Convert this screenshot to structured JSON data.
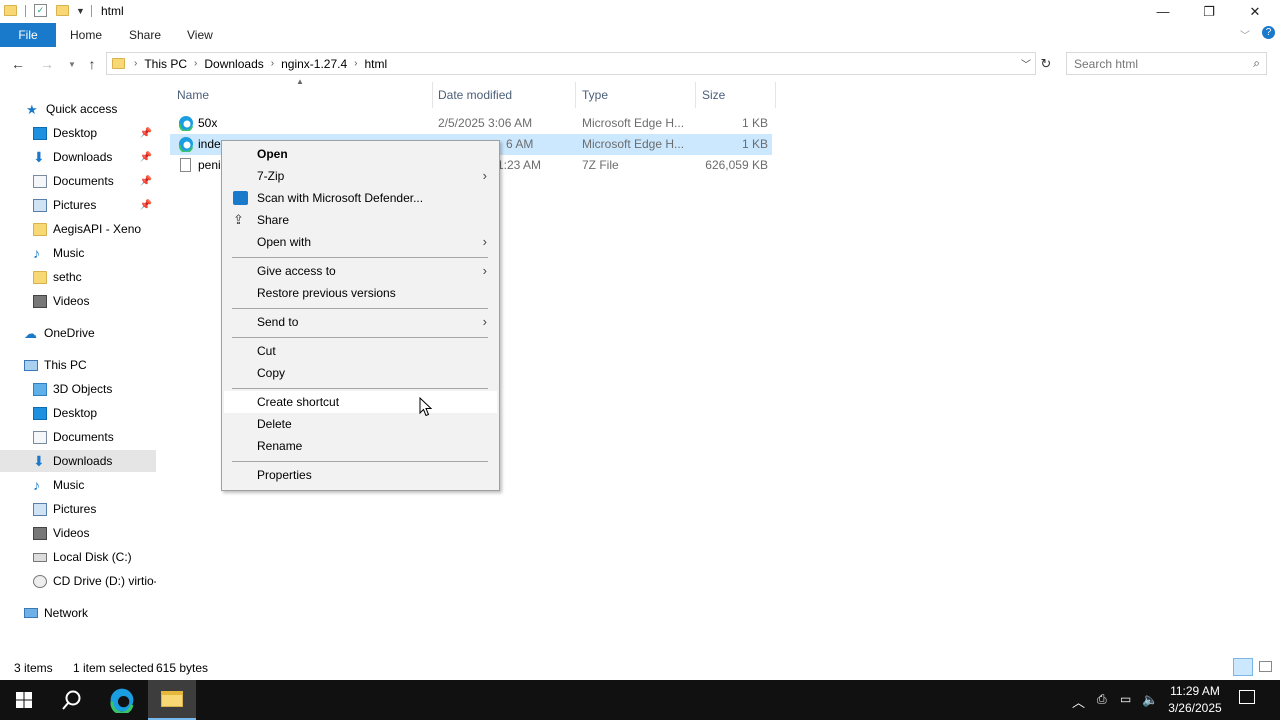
{
  "window": {
    "title": "html",
    "controls": {
      "minimize": "—",
      "restore": "❐",
      "close": "✕"
    }
  },
  "ribbon": {
    "tabs": [
      "File",
      "Home",
      "Share",
      "View"
    ]
  },
  "address": {
    "crumbs": [
      "This PC",
      "Downloads",
      "nginx-1.27.4",
      "html"
    ],
    "search_placeholder": "Search html"
  },
  "sidebar": {
    "quick_access": "Quick access",
    "quick_items": [
      "Desktop",
      "Downloads",
      "Documents",
      "Pictures",
      "AegisAPI - Xeno",
      "Music",
      "sethc",
      "Videos"
    ],
    "onedrive": "OneDrive",
    "this_pc": "This PC",
    "pc_items": [
      "3D Objects",
      "Desktop",
      "Documents",
      "Downloads",
      "Music",
      "Pictures",
      "Videos",
      "Local Disk (C:)",
      "CD Drive (D:) virtio-"
    ],
    "network": "Network"
  },
  "columns": {
    "name": "Name",
    "date": "Date modified",
    "type": "Type",
    "size": "Size"
  },
  "files": [
    {
      "name": "50x",
      "date": "2/5/2025 3:06 AM",
      "type": "Microsoft Edge H...",
      "size": "1 KB",
      "icon": "edge-icon"
    },
    {
      "name": "inde",
      "date": "6 AM",
      "type": "Microsoft Edge H...",
      "size": "1 KB",
      "icon": "edge-icon",
      "selected": true
    },
    {
      "name": "peni",
      "date": "1:23 AM",
      "type": "7Z File",
      "size": "626,059 KB",
      "icon": "file-icon"
    }
  ],
  "context_menu": {
    "open": "Open",
    "zip": "7-Zip",
    "defender": "Scan with Microsoft Defender...",
    "share": "Share",
    "open_with": "Open with",
    "give_access": "Give access to",
    "restore": "Restore previous versions",
    "send_to": "Send to",
    "cut": "Cut",
    "copy": "Copy",
    "create_shortcut": "Create shortcut",
    "delete": "Delete",
    "rename": "Rename",
    "properties": "Properties"
  },
  "status": {
    "items": "3 items",
    "selected": "1 item selected",
    "bytes": "615 bytes"
  },
  "taskbar": {
    "time": "11:29 AM",
    "date": "3/26/2025"
  },
  "colors": {
    "accent": "#1979ca",
    "selection": "#cce8ff",
    "taskbar": "#111111"
  }
}
